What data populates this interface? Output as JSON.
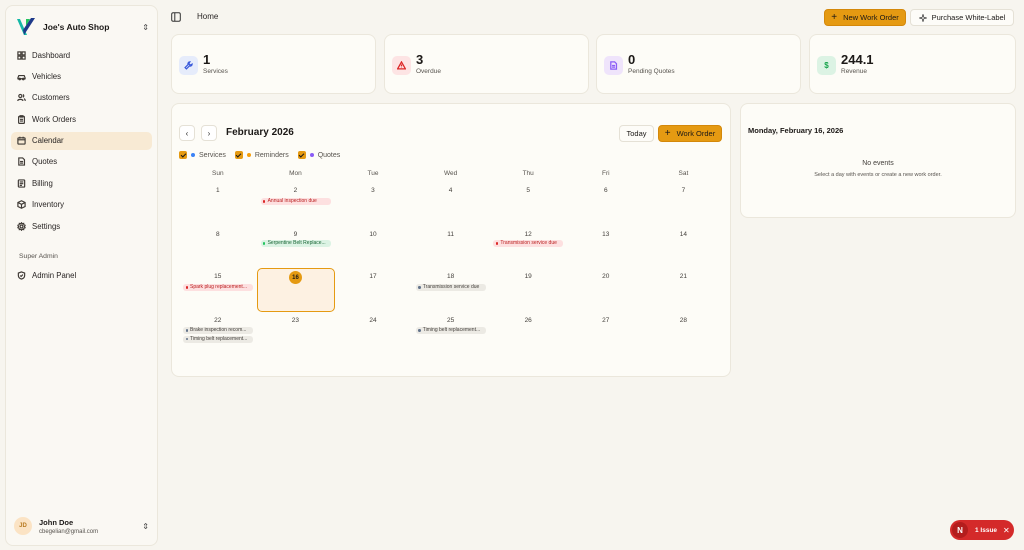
{
  "shop": {
    "name": "Joe's Auto Shop"
  },
  "nav": [
    {
      "label": "Dashboard",
      "icon": "dashboard-icon",
      "active": false
    },
    {
      "label": "Vehicles",
      "icon": "car-icon",
      "active": false
    },
    {
      "label": "Customers",
      "icon": "users-icon",
      "active": false
    },
    {
      "label": "Work Orders",
      "icon": "clipboard-icon",
      "active": false
    },
    {
      "label": "Calendar",
      "icon": "calendar-icon",
      "active": true
    },
    {
      "label": "Quotes",
      "icon": "document-icon",
      "active": false
    },
    {
      "label": "Billing",
      "icon": "billing-icon",
      "active": false
    },
    {
      "label": "Inventory",
      "icon": "box-icon",
      "active": false
    },
    {
      "label": "Settings",
      "icon": "gear-icon",
      "active": false
    }
  ],
  "admin": {
    "section_label": "Super Admin",
    "item_label": "Admin Panel"
  },
  "user": {
    "initials": "JD",
    "name": "John Doe",
    "email": "cbegelian@gmail.com"
  },
  "header": {
    "breadcrumb": "Home",
    "new_work_order_label": "New Work Order",
    "white_label_label": "Purchase White-Label"
  },
  "stats": [
    {
      "value": "1",
      "label": "Services",
      "icon": "wrench-icon",
      "bg": "#e6ecfb",
      "color": "#3b5bdb"
    },
    {
      "value": "3",
      "label": "Overdue",
      "icon": "warning-icon",
      "bg": "#fde4e4",
      "color": "#dc2626"
    },
    {
      "value": "0",
      "label": "Pending Quotes",
      "icon": "document-icon",
      "bg": "#efe4fb",
      "color": "#8b5cf6"
    },
    {
      "value": "244.1",
      "label": "Revenue",
      "icon": "dollar-icon",
      "bg": "#dcf3e4",
      "color": "#16a34a"
    }
  ],
  "calendar": {
    "month_title": "February 2026",
    "today_label": "Today",
    "work_order_label": "Work Order",
    "filters": [
      {
        "label": "Services",
        "color": "#3b82f6"
      },
      {
        "label": "Reminders",
        "color": "#f59e0b"
      },
      {
        "label": "Quotes",
        "color": "#8b5cf6"
      }
    ],
    "weekdays": [
      "Sun",
      "Mon",
      "Tue",
      "Wed",
      "Thu",
      "Fri",
      "Sat"
    ],
    "weeks": [
      [
        "1",
        "2",
        "3",
        "4",
        "5",
        "6",
        "7"
      ],
      [
        "8",
        "9",
        "10",
        "11",
        "12",
        "13",
        "14"
      ],
      [
        "15",
        "16",
        "17",
        "18",
        "19",
        "20",
        "21"
      ],
      [
        "22",
        "23",
        "24",
        "25",
        "26",
        "27",
        "28"
      ]
    ],
    "today": "16",
    "events": [
      {
        "week": 0,
        "day": 1,
        "slot": 0,
        "kind": "red",
        "text": "Annual inspection due"
      },
      {
        "week": 1,
        "day": 1,
        "slot": 0,
        "kind": "green",
        "text": "Serpentine Belt Replace..."
      },
      {
        "week": 1,
        "day": 4,
        "slot": 0,
        "kind": "red",
        "text": "Transmission service due"
      },
      {
        "week": 2,
        "day": 0,
        "slot": 0,
        "kind": "red",
        "text": "Spark plug replacement..."
      },
      {
        "week": 2,
        "day": 3,
        "slot": 0,
        "kind": "gray",
        "text": "Transmission service due"
      },
      {
        "week": 3,
        "day": 0,
        "slot": 0,
        "kind": "gray",
        "text": "Brake inspection recom..."
      },
      {
        "week": 3,
        "day": 0,
        "slot": 1,
        "kind": "gray",
        "text": "Timing belt replacement..."
      },
      {
        "week": 3,
        "day": 3,
        "slot": 0,
        "kind": "gray",
        "text": "Timing belt replacement..."
      }
    ]
  },
  "day_panel": {
    "title": "Monday, February 16, 2026",
    "empty_title": "No events",
    "empty_subtitle": "Select a day with events or create a new work order."
  },
  "issue_badge": {
    "letter": "N",
    "label": "1 Issue"
  }
}
